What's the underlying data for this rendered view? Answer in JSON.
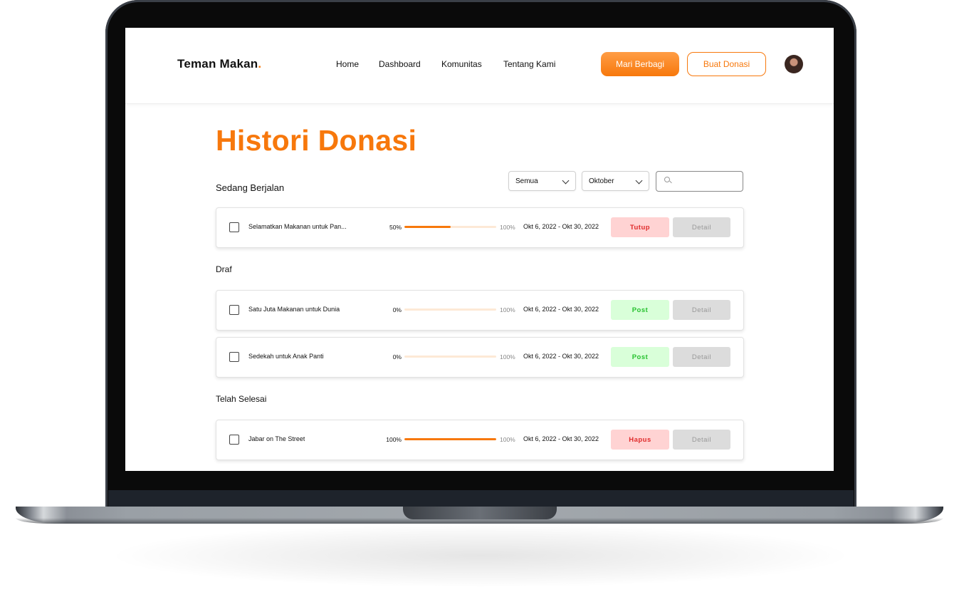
{
  "navbar": {
    "logo_text": "Teman Makan",
    "logo_dot": ".",
    "links": [
      "Home",
      "Dashboard",
      "Komunitas",
      "Tentang Kami"
    ],
    "primary_button": "Mari Berbagi",
    "outline_button": "Buat Donasi"
  },
  "page": {
    "title": "Histori Donasi"
  },
  "filters": {
    "category_value": "Semua",
    "month_value": "Oktober",
    "search_value": ""
  },
  "sections": {
    "running": {
      "label": "Sedang Berjalan",
      "items": [
        {
          "title": "Selamatkan Makanan untuk Pan...",
          "progress": 50,
          "progress_label": "50%",
          "target_label": "100%",
          "date": "Okt 6, 2022 - Okt 30, 2022",
          "action": "Tutup",
          "detail": "Detail"
        }
      ]
    },
    "draft": {
      "label": "Draf",
      "items": [
        {
          "title": "Satu Juta Makanan untuk Dunia",
          "progress": 0,
          "progress_label": "0%",
          "target_label": "100%",
          "date": "Okt 6, 2022 - Okt 30, 2022",
          "action": "Post",
          "detail": "Detail"
        },
        {
          "title": "Sedekah untuk Anak Panti",
          "progress": 0,
          "progress_label": "0%",
          "target_label": "100%",
          "date": "Okt 6, 2022 - Okt 30, 2022",
          "action": "Post",
          "detail": "Detail"
        }
      ]
    },
    "done": {
      "label": "Telah Selesai",
      "items": [
        {
          "title": "Jabar on The Street",
          "progress": 100,
          "progress_label": "100%",
          "target_label": "100%",
          "date": "Okt 6, 2022 - Okt 30, 2022",
          "action": "Hapus",
          "detail": "Detail"
        }
      ]
    }
  },
  "colors": {
    "brand_orange": "#f7780c",
    "danger_bg": "#ffd3d3",
    "danger_text": "#e02b2b",
    "success_bg": "#d9ffd9",
    "success_text": "#27c22f",
    "detail_bg": "#dcdcdc"
  }
}
